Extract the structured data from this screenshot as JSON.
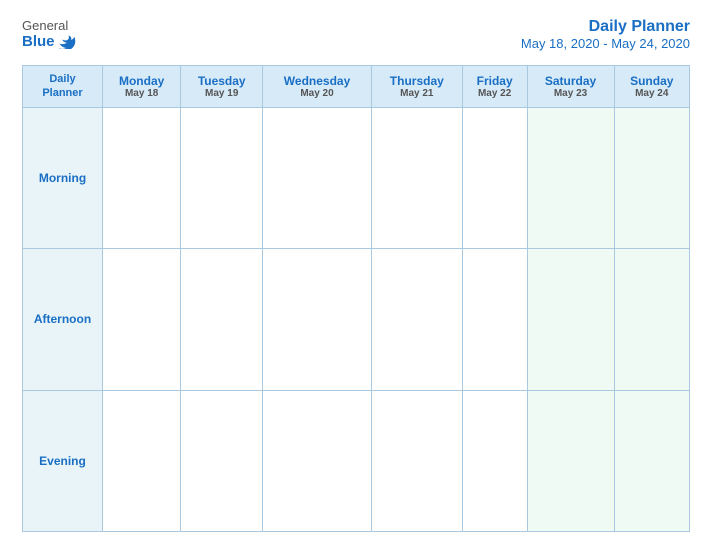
{
  "logo": {
    "general": "General",
    "blue": "Blue"
  },
  "header": {
    "title": "Daily Planner",
    "date_range": "May 18, 2020 - May 24, 2020"
  },
  "table": {
    "row_header": {
      "line1": "Daily",
      "line2": "Planner"
    },
    "columns": [
      {
        "day": "Monday",
        "date": "May 18"
      },
      {
        "day": "Tuesday",
        "date": "May 19"
      },
      {
        "day": "Wednesday",
        "date": "May 20"
      },
      {
        "day": "Thursday",
        "date": "May 21"
      },
      {
        "day": "Friday",
        "date": "May 22"
      },
      {
        "day": "Saturday",
        "date": "May 23"
      },
      {
        "day": "Sunday",
        "date": "May 24"
      }
    ],
    "rows": [
      {
        "label": "Morning"
      },
      {
        "label": "Afternoon"
      },
      {
        "label": "Evening"
      }
    ]
  }
}
